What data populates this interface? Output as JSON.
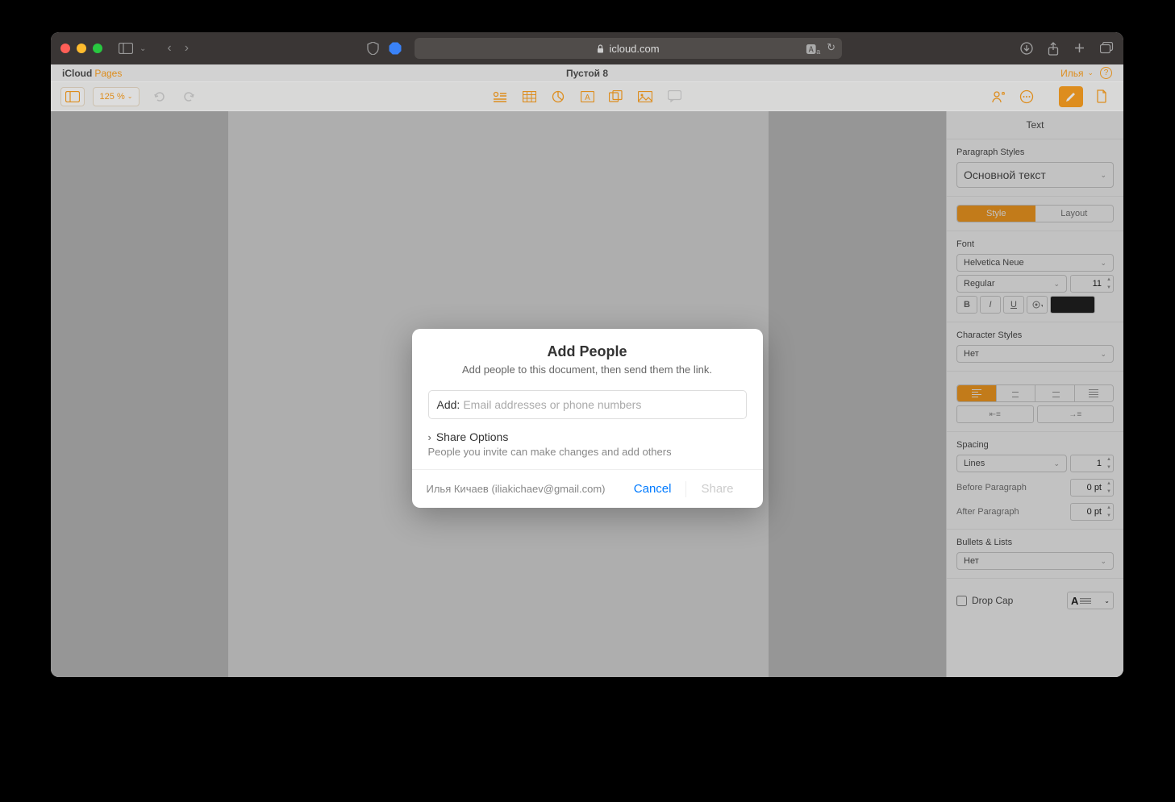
{
  "browser": {
    "url": "icloud.com"
  },
  "header": {
    "app_prefix": "iCloud",
    "app_name": "Pages",
    "doc_title": "Пустой 8",
    "user_name": "Илья"
  },
  "toolbar": {
    "zoom": "125 %"
  },
  "inspector": {
    "title": "Text",
    "paragraph_styles_label": "Paragraph Styles",
    "paragraph_style": "Основной текст",
    "tab_style": "Style",
    "tab_layout": "Layout",
    "font_label": "Font",
    "font_family": "Helvetica Neue",
    "font_weight": "Regular",
    "font_size": "11",
    "char_styles_label": "Character Styles",
    "char_style": "Нет",
    "spacing_label": "Spacing",
    "spacing_mode": "Lines",
    "spacing_value": "1",
    "before_para_label": "Before Paragraph",
    "before_para_value": "0 pt",
    "after_para_label": "After Paragraph",
    "after_para_value": "0 pt",
    "bullets_label": "Bullets & Lists",
    "bullets_value": "Нет",
    "dropcap_label": "Drop Cap"
  },
  "modal": {
    "title": "Add People",
    "subtitle": "Add people to this document, then send them the link.",
    "add_label": "Add:",
    "add_placeholder": "Email addresses or phone numbers",
    "share_options_label": "Share Options",
    "share_desc": "People you invite can make changes and add others",
    "owner": "Илья Кичаев (iliakichaev@gmail.com)",
    "cancel": "Cancel",
    "share": "Share"
  }
}
